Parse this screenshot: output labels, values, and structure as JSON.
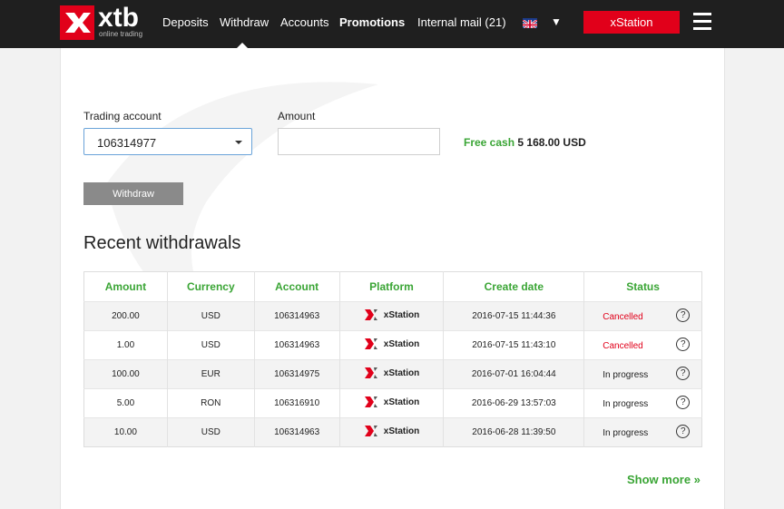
{
  "brand": {
    "name": "xtb",
    "tagline": "online trading",
    "accent": "#e1001a",
    "green": "#3aa535"
  },
  "nav": {
    "deposits": "Deposits",
    "withdraw": "Withdraw",
    "accounts": "Accounts",
    "promotions": "Promotions",
    "internal_mail": "Internal mail (21)",
    "lang_caret": "▼",
    "xstation": "xStation",
    "flag_icon": "uk-flag-icon",
    "menu_icon": "hamburger-icon"
  },
  "form": {
    "trading_account_label": "Trading account",
    "trading_account_value": "106314977",
    "amount_label": "Amount",
    "amount_value": "",
    "free_cash_label": "Free cash",
    "free_cash_value": "5 168.00 USD",
    "withdraw_button": "Withdraw"
  },
  "recent": {
    "title": "Recent withdrawals",
    "columns": [
      "Amount",
      "Currency",
      "Account",
      "Platform",
      "Create date",
      "Status"
    ],
    "rows": [
      {
        "amount": "200.00",
        "currency": "USD",
        "account": "106314963",
        "platform": "xStation",
        "date": "2016-07-15 11:44:36",
        "status": "Cancelled"
      },
      {
        "amount": "1.00",
        "currency": "USD",
        "account": "106314963",
        "platform": "xStation",
        "date": "2016-07-15 11:43:10",
        "status": "Cancelled"
      },
      {
        "amount": "100.00",
        "currency": "EUR",
        "account": "106314975",
        "platform": "xStation",
        "date": "2016-07-01 16:04:44",
        "status": "In progress"
      },
      {
        "amount": "5.00",
        "currency": "RON",
        "account": "106316910",
        "platform": "xStation",
        "date": "2016-06-29 13:57:03",
        "status": "In progress"
      },
      {
        "amount": "10.00",
        "currency": "USD",
        "account": "106314963",
        "platform": "xStation",
        "date": "2016-06-28 11:39:50",
        "status": "In progress"
      }
    ],
    "help_glyph": "?",
    "show_more": "Show more »"
  }
}
